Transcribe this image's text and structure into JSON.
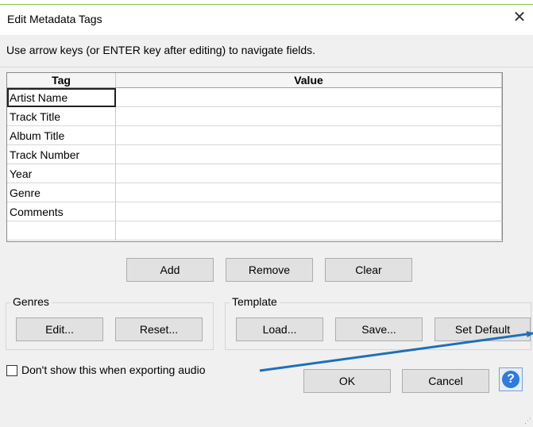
{
  "dialog": {
    "title": "Edit Metadata Tags",
    "close_glyph": "✕",
    "hint": "Use arrow keys (or ENTER key after editing) to navigate fields."
  },
  "table": {
    "headers": [
      "Tag",
      "Value"
    ],
    "rows": [
      {
        "tag": "Artist Name",
        "value": ""
      },
      {
        "tag": "Track Title",
        "value": ""
      },
      {
        "tag": "Album Title",
        "value": ""
      },
      {
        "tag": "Track Number",
        "value": ""
      },
      {
        "tag": "Year",
        "value": ""
      },
      {
        "tag": "Genre",
        "value": ""
      },
      {
        "tag": "Comments",
        "value": ""
      },
      {
        "tag": "",
        "value": ""
      }
    ]
  },
  "actions": {
    "add": "Add",
    "remove": "Remove",
    "clear": "Clear"
  },
  "genres": {
    "label": "Genres",
    "edit": "Edit...",
    "reset": "Reset..."
  },
  "template": {
    "label": "Template",
    "load": "Load...",
    "save": "Save...",
    "set_default": "Set Default"
  },
  "checkbox": {
    "label": "Don't show this when exporting audio",
    "checked": false
  },
  "footer": {
    "ok": "OK",
    "cancel": "Cancel",
    "help_glyph": "?"
  },
  "colors": {
    "accent_arrow": "#1f6fb8",
    "help_blue": "#2f7be0",
    "top_line": "#8cc63f"
  },
  "icons": {
    "close": "close-icon",
    "help": "help-icon",
    "arrow": "annotation-arrow-icon"
  }
}
